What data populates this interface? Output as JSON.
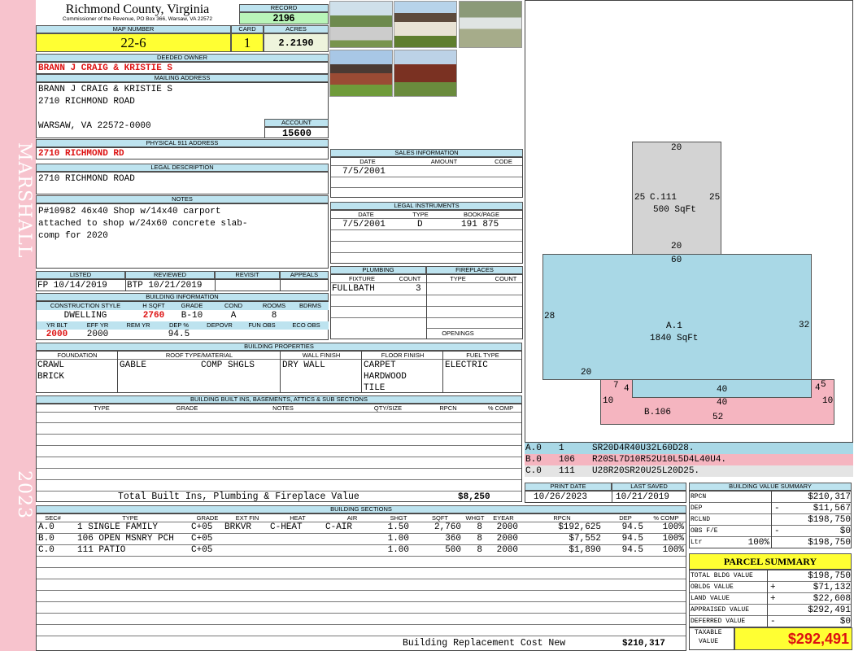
{
  "sidebar": {
    "top": "MARSHALL",
    "bottom": "2023"
  },
  "header": {
    "county": "Richmond County, Virginia",
    "subtitle": "Commissioner of the Revenue, PO Box 366, Warsaw, VA 22572",
    "record_label": "RECORD",
    "record": "2196",
    "map_label": "MAP NUMBER",
    "map": "22-6",
    "card_label": "CARD",
    "card": "1",
    "acres_label": "ACRES",
    "acres": "2.2190"
  },
  "owner": {
    "deeded_label": "DEEDED OWNER",
    "deeded": "BRANN J CRAIG & KRISTIE S",
    "mailing_label": "MAILING ADDRESS",
    "mail1": "BRANN J CRAIG & KRISTIE S",
    "mail2": "2710 RICHMOND ROAD",
    "mail3": "WARSAW, VA 22572-0000",
    "account_label": "ACCOUNT",
    "account": "15600",
    "phys_label": "PHYSICAL 911 ADDRESS",
    "phys": "2710 RICHMOND RD",
    "legal_label": "LEGAL DESCRIPTION",
    "legal": "2710 RICHMOND ROAD",
    "notes_label": "NOTES",
    "note1": "P#10982 46x40 Shop w/14x40 carport",
    "note2": "attached to shop w/24x60 concrete slab-",
    "note3": "comp for 2020"
  },
  "listing": {
    "listed_label": "LISTED",
    "listed": "FP  10/14/2019",
    "reviewed_label": "REVIEWED",
    "reviewed": "BTP 10/21/2019",
    "revisit_label": "REVISIT",
    "appeals_label": "APPEALS"
  },
  "bldg_info": {
    "title": "BUILDING INFORMATION",
    "cs_label": "CONSTRUCTION STYLE",
    "hs_label": "H SQFT",
    "grade_label": "GRADE",
    "cond_label": "COND",
    "rooms_label": "ROOMS",
    "bdrms_label": "BDRMS",
    "style": "DWELLING",
    "hsqft": "2760",
    "grade": "B-10",
    "cond": "A",
    "rooms": "8",
    "yb_label": "YR BLT",
    "ey_label": "EFF YR",
    "rem_label": "REM YR",
    "dep_label": "DEP %",
    "depovr_label": "DEPOVR",
    "funobs_label": "FUN OBS",
    "ecoobs_label": "ECO OBS",
    "yrblt": "2000",
    "effyr": "2000",
    "dep": "94.5"
  },
  "sales": {
    "title": "SALES INFORMATION",
    "date_label": "DATE",
    "amount_label": "AMOUNT",
    "code_label": "CODE",
    "date": "7/5/2001"
  },
  "legal_inst": {
    "title": "LEGAL INSTRUMENTS",
    "date_label": "DATE",
    "type_label": "TYPE",
    "bp_label": "BOOK/PAGE",
    "date": "7/5/2001",
    "type": "D",
    "bookpage": "191 875"
  },
  "plumbing": {
    "title": "PLUMBING",
    "fixture_label": "FIXTURE",
    "count_label": "COUNT",
    "fixture": "FULLBATH",
    "count": "3"
  },
  "fireplaces": {
    "title": "FIREPLACES",
    "type_label": "TYPE",
    "count_label": "COUNT",
    "openings_label": "OPENINGS"
  },
  "props": {
    "title": "BUILDING PROPERTIES",
    "found_label": "FOUNDATION",
    "roof_label": "ROOF TYPE/MATERIAL",
    "wall_label": "WALL FINISH",
    "floor_label": "FLOOR FINISH",
    "fuel_label": "FUEL TYPE",
    "found1": "CRAWL",
    "found2": "BRICK",
    "roof1": "GABLE",
    "roof2": "COMP SHGLS",
    "wall": "DRY WALL",
    "floor1": "CARPET",
    "floor2": "HARDWOOD",
    "floor3": "TILE",
    "fuel": "ELECTRIC"
  },
  "builtins": {
    "title": "BUILDING BUILT INS, BASEMENTS, ATTICS & SUB SECTIONS",
    "type_label": "TYPE",
    "grade_label": "GRADE",
    "notes_label": "NOTES",
    "qty_label": "QTY/SIZE",
    "rpcn_label": "RPCN",
    "pct_label": "% COMP",
    "total_label": "Total Built Ins, Plumbing & Fireplace Value",
    "total": "$8,250"
  },
  "dates": {
    "print_label": "PRINT DATE",
    "print": "10/26/2023",
    "saved_label": "LAST SAVED",
    "saved": "10/21/2019"
  },
  "sections": {
    "title": "BUILDING SECTIONS",
    "headers": [
      "SEC#",
      "TYPE",
      "GRADE",
      "EXT FIN",
      "HEAT",
      "AIR",
      "SHGT",
      "SQFT",
      "WHGT",
      "EYEAR",
      "RPCN",
      "DEP",
      "% COMP"
    ],
    "rows": [
      [
        "A.0",
        "1 SINGLE FAMILY",
        "C+05",
        "BRKVR",
        "C-HEAT",
        "C-AIR",
        "1.50",
        "2,760",
        "8",
        "2000",
        "$192,625",
        "94.5",
        "100%"
      ],
      [
        "B.0",
        "106 OPEN MSNRY PCH",
        "C+05",
        "",
        "",
        "",
        "1.00",
        "360",
        "8",
        "2000",
        "$7,552",
        "94.5",
        "100%"
      ],
      [
        "C.0",
        "111 PATIO",
        "C+05",
        "",
        "",
        "",
        "1.00",
        "500",
        "8",
        "2000",
        "$1,890",
        "94.5",
        "100%"
      ]
    ],
    "rcn_label": "Building Replacement Cost New",
    "rcn": "$210,317"
  },
  "sketch": {
    "c_label": "C.111",
    "c_area": "500 SqFt",
    "a_label": "A.1",
    "a_area": "1840 SqFt",
    "b_label": "B.106",
    "dims": [
      "20",
      "25",
      "25",
      "20",
      "60",
      "28",
      "32",
      "20",
      "7",
      "4",
      "40",
      "4",
      "5",
      "10",
      "40",
      "10",
      "52"
    ],
    "legend": [
      {
        "sec": "A.0",
        "code": "1",
        "path": "SR20D4R40U32L60D28."
      },
      {
        "sec": "B.0",
        "code": "106",
        "path": "R20SL7D10R52U10L5D4L40U4."
      },
      {
        "sec": "C.0",
        "code": "111",
        "path": "U28R20SR20U25L20D25."
      }
    ],
    "colors": {
      "a": "#a9d8e6",
      "b": "#f5b5c0",
      "c": "#d3d3d3"
    }
  },
  "bvs": {
    "title": "BUILDING VALUE SUMMARY",
    "rows": [
      {
        "label": "RPCN",
        "sign": "",
        "pct": "",
        "value": "$210,317"
      },
      {
        "label": "DEP",
        "sign": "-",
        "pct": "",
        "value": "$11,567"
      },
      {
        "label": "RCLND",
        "sign": "",
        "pct": "",
        "value": "$198,750"
      },
      {
        "label": "OBS F/E",
        "sign": "-",
        "pct": "",
        "value": "$0"
      },
      {
        "label": "Ltr",
        "sign": "",
        "pct": "100%",
        "value": "$198,750"
      }
    ]
  },
  "parcel": {
    "title": "PARCEL SUMMARY",
    "rows": [
      {
        "label": "TOTAL BLDG VALUE",
        "sign": "",
        "value": "$198,750"
      },
      {
        "label": "OBLDG VALUE",
        "sign": "+",
        "value": "$71,132"
      },
      {
        "label": "LAND VALUE",
        "sign": "+",
        "value": "$22,608"
      },
      {
        "label": "APPRAISED VALUE",
        "sign": "",
        "value": "$292,491"
      },
      {
        "label": "DEFERRED VALUE",
        "sign": "-",
        "value": "$0"
      }
    ],
    "taxable_label1": "TAXABLE",
    "taxable_label2": "VALUE",
    "taxable": "$292,491"
  },
  "photos": [
    "mobile-home-photo",
    "two-story-house-photo",
    "ranch-house-photo",
    "brick-house-photo",
    "brick-shop-photo"
  ]
}
